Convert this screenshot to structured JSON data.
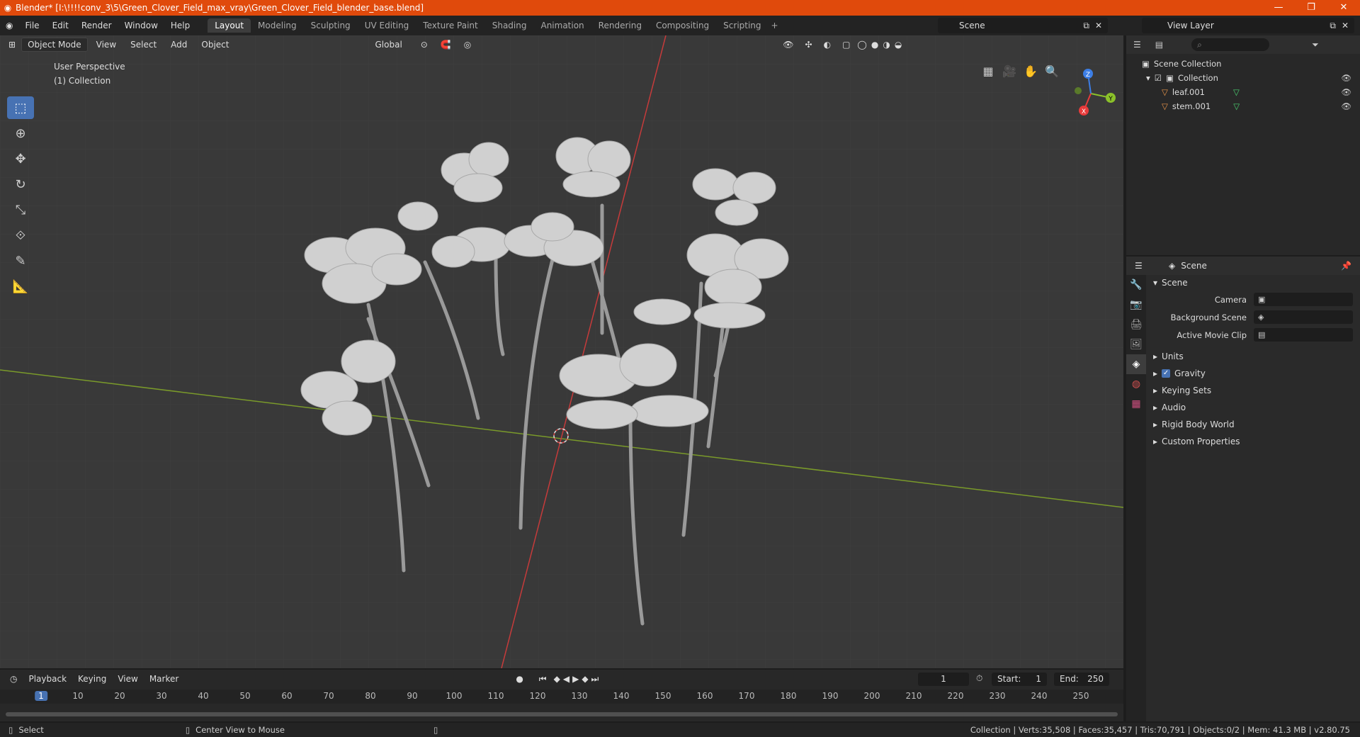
{
  "window": {
    "title": "Blender* [I:\\!!!!conv_3\\5\\Green_Clover_Field_max_vray\\Green_Clover_Field_blender_base.blend]"
  },
  "menu": [
    "File",
    "Edit",
    "Render",
    "Window",
    "Help"
  ],
  "workspaces": [
    "Layout",
    "Modeling",
    "Sculpting",
    "UV Editing",
    "Texture Paint",
    "Shading",
    "Animation",
    "Rendering",
    "Compositing",
    "Scripting"
  ],
  "scene_name": "Scene",
  "view_layer": "View Layer",
  "viewport": {
    "mode": "Object Mode",
    "menus": [
      "View",
      "Select",
      "Add",
      "Object"
    ],
    "transform": "Global",
    "info_line1": "User Perspective",
    "info_line2": "(1) Collection",
    "gizmo": {
      "x": "X",
      "y": "Y",
      "z": "Z"
    }
  },
  "outliner": {
    "root": "Scene Collection",
    "collection": "Collection",
    "items": [
      "leaf.001",
      "stem.001"
    ]
  },
  "properties": {
    "header": "Scene",
    "panel": "Scene",
    "camera_label": "Camera",
    "bg_scene_label": "Background Scene",
    "movie_clip_label": "Active Movie Clip",
    "sections": [
      "Units",
      "Gravity",
      "Keying Sets",
      "Audio",
      "Rigid Body World",
      "Custom Properties"
    ]
  },
  "timeline": {
    "menus": [
      "Playback",
      "Keying",
      "View",
      "Marker"
    ],
    "current_frame": "1",
    "start_label": "Start:",
    "start": "1",
    "end_label": "End:",
    "end": "250",
    "ticks": [
      "10",
      "20",
      "30",
      "40",
      "50",
      "60",
      "70",
      "80",
      "90",
      "100",
      "110",
      "120",
      "130",
      "140",
      "150",
      "160",
      "170",
      "180",
      "190",
      "200",
      "210",
      "220",
      "230",
      "240",
      "250"
    ]
  },
  "status": {
    "left": "Select",
    "middle": "Center View to Mouse",
    "right": "Collection | Verts:35,508 | Faces:35,457 | Tris:70,791 | Objects:0/2 | Mem: 41.3 MB | v2.80.75"
  },
  "colors": {
    "accent": "#4772b3",
    "title_bar": "#e04a0c",
    "x_axis": "#e83b3b",
    "y_axis": "#8bc12a",
    "z_axis": "#3c7ee6"
  }
}
